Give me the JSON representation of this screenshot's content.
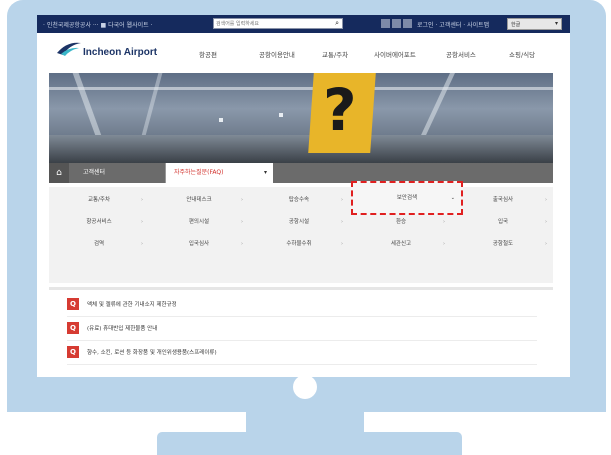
{
  "topbar": {
    "site_links": "· 인천국제공항공사 ··· ■ 다국어 웹사이트 ·",
    "search_placeholder": "검색어를 입력하세요",
    "util_links": "로그인 · 고객센터 · 사이트맵",
    "language": "한글"
  },
  "header": {
    "logo": "Incheon Airport",
    "nav": [
      "항공편",
      "공항이용안내",
      "교통/주차",
      "사이버에어포트",
      "공항서비스",
      "쇼핑/식당"
    ]
  },
  "hero": {
    "sign_symbol": "?"
  },
  "breadcrumb": {
    "home_icon": "home-icon",
    "level1": "고객센터",
    "level2": "자주하는질문(FAQ)",
    "dropdown_arrow": "▾"
  },
  "submenu": {
    "rows": [
      [
        "교통/주차",
        "안내데스크",
        "탑승수속",
        "보안검색",
        "출국심사"
      ],
      [
        "항공서비스",
        "편의시설",
        "공항시설",
        "환승",
        "입국"
      ],
      [
        "검역",
        "입국심사",
        "수하물수취",
        "세관신고",
        "공항철도"
      ]
    ],
    "selected": "보안검색"
  },
  "faq": {
    "items": [
      "액체 및 젤류에 관한 기내소지 제한규정",
      "(유료) 휴대반입 제한물품 안내",
      "향수, 소킨, 로션 등 화장품 및 개인위생용품(스프레이류)"
    ],
    "marker": "Q"
  },
  "colors": {
    "monitor": "#b9d4ea",
    "topbar": "#152a5d",
    "accent_red": "#d63b32",
    "highlight_dash": "#e02020"
  }
}
